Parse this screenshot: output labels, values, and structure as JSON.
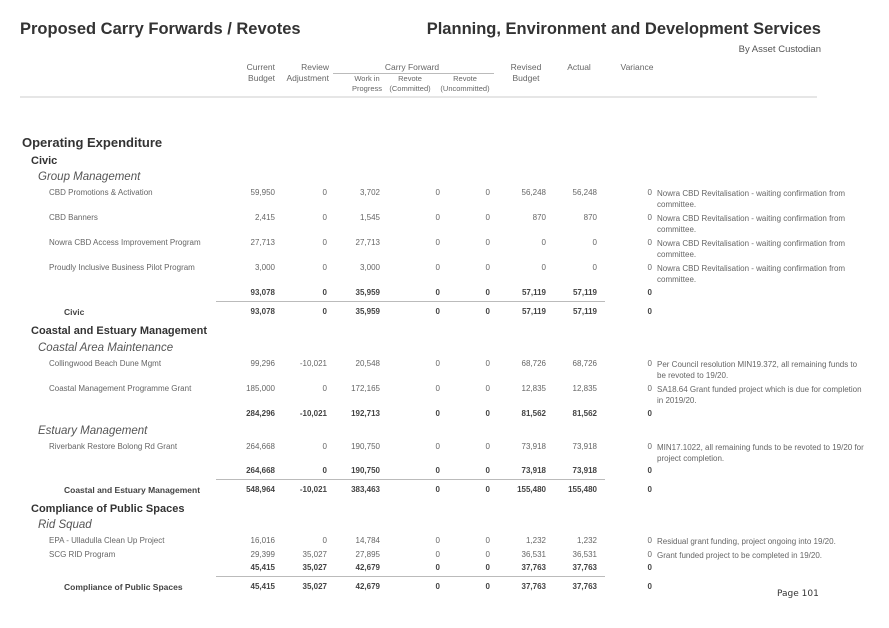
{
  "header": {
    "title_left": "Proposed Carry Forwards / Revotes",
    "title_right": "Planning, Environment and Development Services",
    "subtitle": "By Asset Custodian"
  },
  "columns": {
    "current_budget": [
      "Current",
      "Budget"
    ],
    "review_adjustment": [
      "Review",
      "Adjustment"
    ],
    "carry_forward": "Carry Forward",
    "work_in_progress": [
      "Work in",
      "Progress"
    ],
    "revote_committed": [
      "Revote",
      "(Committed)"
    ],
    "revote_uncommitted": [
      "Revote",
      "(Uncommitted)"
    ],
    "revised_budget": [
      "Revised",
      "Budget"
    ],
    "actual": "Actual",
    "variance": "Variance"
  },
  "section_title": "Operating Expenditure",
  "divisions": [
    {
      "name": "Civic",
      "groups": [
        {
          "name": "Group Management",
          "items": [
            {
              "name": "CBD Promotions & Activation",
              "values": [
                "59,950",
                "0",
                "3,702",
                "0",
                "0",
                "56,248",
                "56,248",
                "0"
              ],
              "note": "Nowra CBD Revitalisation - waiting confirmation from committee."
            },
            {
              "name": "CBD Banners",
              "values": [
                "2,415",
                "0",
                "1,545",
                "0",
                "0",
                "870",
                "870",
                "0"
              ],
              "note": "Nowra CBD Revitalisation - waiting confirmation from committee."
            },
            {
              "name": "Nowra CBD Access Improvement Program",
              "values": [
                "27,713",
                "0",
                "27,713",
                "0",
                "0",
                "0",
                "0",
                "0"
              ],
              "note": "Nowra CBD Revitalisation - waiting confirmation from committee."
            },
            {
              "name": "Proudly Inclusive Business Pilot Program",
              "values": [
                "3,000",
                "0",
                "3,000",
                "0",
                "0",
                "0",
                "0",
                "0"
              ],
              "note": "Nowra CBD Revitalisation - waiting confirmation from committee."
            }
          ],
          "subtotal": [
            "93,078",
            "0",
            "35,959",
            "0",
            "0",
            "57,119",
            "57,119",
            "0"
          ]
        }
      ],
      "total_label": "Civic",
      "total": [
        "93,078",
        "0",
        "35,959",
        "0",
        "0",
        "57,119",
        "57,119",
        "0"
      ]
    },
    {
      "name": "Coastal and Estuary Management",
      "groups": [
        {
          "name": "Coastal Area Maintenance",
          "items": [
            {
              "name": "Collingwood Beach Dune Mgmt",
              "values": [
                "99,296",
                "-10,021",
                "20,548",
                "0",
                "0",
                "68,726",
                "68,726",
                "0"
              ],
              "note": "Per Council resolution MIN19.372, all remaining funds to be revoted to 19/20."
            },
            {
              "name": "Coastal Management Programme Grant",
              "values": [
                "185,000",
                "0",
                "172,165",
                "0",
                "0",
                "12,835",
                "12,835",
                "0"
              ],
              "note": "SA18.64 Grant funded project which is due for completion in 2019/20."
            }
          ],
          "subtotal": [
            "284,296",
            "-10,021",
            "192,713",
            "0",
            "0",
            "81,562",
            "81,562",
            "0"
          ]
        },
        {
          "name": "Estuary Management",
          "items": [
            {
              "name": "Riverbank Restore Bolong Rd Grant",
              "values": [
                "264,668",
                "0",
                "190,750",
                "0",
                "0",
                "73,918",
                "73,918",
                "0"
              ],
              "note": "MIN17.1022, all remaining funds to be revoted to 19/20 for project completion."
            }
          ],
          "subtotal": [
            "264,668",
            "0",
            "190,750",
            "0",
            "0",
            "73,918",
            "73,918",
            "0"
          ]
        }
      ],
      "total_label": "Coastal and Estuary Management",
      "total": [
        "548,964",
        "-10,021",
        "383,463",
        "0",
        "0",
        "155,480",
        "155,480",
        "0"
      ]
    },
    {
      "name": "Compliance of Public Spaces",
      "groups": [
        {
          "name": "Rid Squad",
          "items": [
            {
              "name": "EPA - Ulladulla Clean Up Project",
              "values": [
                "16,016",
                "0",
                "14,784",
                "0",
                "0",
                "1,232",
                "1,232",
                "0"
              ],
              "note": "Residual grant funding, project ongoing into 19/20."
            },
            {
              "name": "SCG RID Program",
              "values": [
                "29,399",
                "35,027",
                "27,895",
                "0",
                "0",
                "36,531",
                "36,531",
                "0"
              ],
              "note": "Grant funded project to be completed in 19/20."
            }
          ],
          "subtotal": [
            "45,415",
            "35,027",
            "42,679",
            "0",
            "0",
            "37,763",
            "37,763",
            "0"
          ]
        }
      ],
      "total_label": "Compliance of Public Spaces",
      "total": [
        "45,415",
        "35,027",
        "42,679",
        "0",
        "0",
        "37,763",
        "37,763",
        "0"
      ]
    }
  ],
  "footer": {
    "page": "Page 101"
  }
}
